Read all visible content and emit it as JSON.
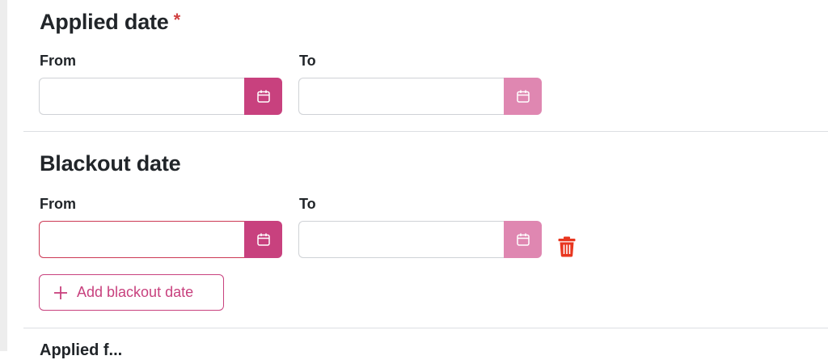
{
  "applied_date": {
    "title": "Applied date",
    "required_marker": "*",
    "from_label": "From",
    "to_label": "To",
    "from_value": "",
    "to_value": ""
  },
  "blackout_date": {
    "title": "Blackout date",
    "from_label": "From",
    "to_label": "To",
    "from_value": "",
    "to_value": "",
    "add_button_label": "Add blackout date"
  },
  "next_section": {
    "title_partial": "Applied f..."
  },
  "icons": {
    "calendar": "calendar-icon",
    "delete": "trash-icon",
    "add": "plus-icon"
  },
  "colors": {
    "accent": "#c8417e",
    "accent_disabled": "#df87b1",
    "danger": "#e8361f",
    "error_border": "#cc3a55",
    "required": "#d04040"
  }
}
